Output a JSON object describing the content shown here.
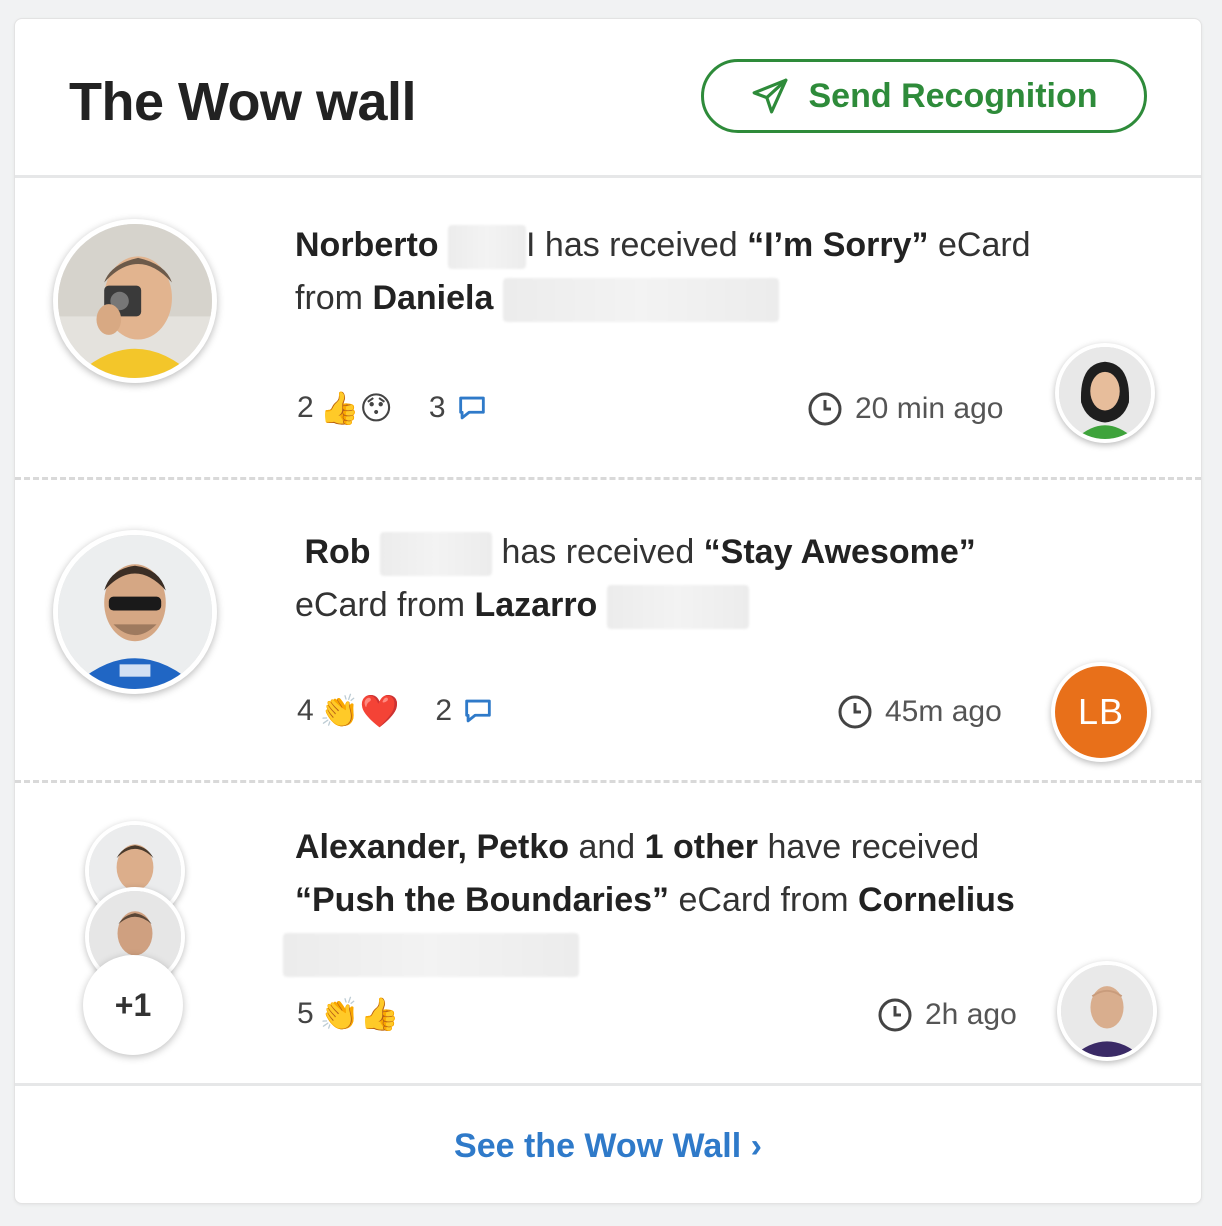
{
  "header": {
    "title": "The Wow wall",
    "send_button_label": "Send Recognition",
    "accent_color": "#2e8b3a"
  },
  "items": [
    {
      "recipient": "Norberto",
      "recipient_suffix": "I",
      "received_text": " has received ",
      "card_name": "“I’m Sorry”",
      "card_suffix": " eCard",
      "from_text": "from ",
      "sender": "Daniela",
      "reaction_count": "2",
      "reaction_emojis": [
        "thumbs-up-emoji",
        "surprised-emoji"
      ],
      "comment_count": "3",
      "time": "20 min ago"
    },
    {
      "recipient": "Rob",
      "received_text": " has received ",
      "card_name": "“Stay Awesome”",
      "from_text": "eCard from ",
      "sender": "Lazarro",
      "sender_initials": "LB",
      "reaction_count": "4",
      "reaction_emojis": [
        "clapping-emoji",
        "heart-emoji"
      ],
      "comment_count": "2",
      "time": "45m ago"
    },
    {
      "recipient_1": "Alexander",
      "recipient_2": "Petko",
      "and_text": " and ",
      "others_text": "1 other",
      "received_text": " have received",
      "card_name": "“Push the Boundaries”",
      "from_text": " eCard from ",
      "sender": "Cornelius",
      "extra_recipients": "+1",
      "reaction_count": "5",
      "reaction_emojis": [
        "clapping-emoji",
        "thumbs-up-emoji"
      ],
      "time": "2h ago"
    }
  ],
  "footer": {
    "link_label": "See the Wow Wall ›",
    "link_color": "#2f7ac9"
  }
}
